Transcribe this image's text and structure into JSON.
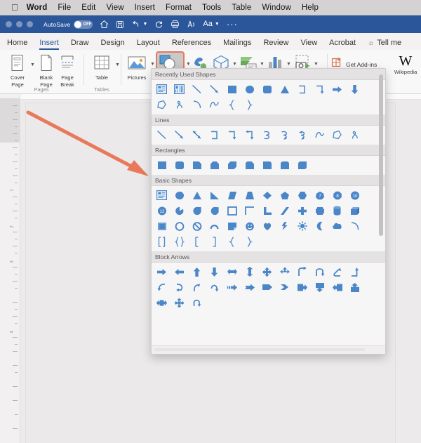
{
  "app": {
    "name": "Word",
    "accent_blue": "#2b579a",
    "shape_blue": "#4a86c8",
    "highlight_orange": "#e8795a"
  },
  "macmenu": {
    "apple_icon": "apple-icon",
    "items": [
      {
        "label": "Word",
        "bold": true
      },
      {
        "label": "File",
        "bold": false
      },
      {
        "label": "Edit",
        "bold": false
      },
      {
        "label": "View",
        "bold": false
      },
      {
        "label": "Insert",
        "bold": false
      },
      {
        "label": "Format",
        "bold": false
      },
      {
        "label": "Tools",
        "bold": false
      },
      {
        "label": "Table",
        "bold": false
      },
      {
        "label": "Window",
        "bold": false
      },
      {
        "label": "Help",
        "bold": false
      }
    ]
  },
  "quickaccess": {
    "autosave_label": "AutoSave",
    "autosave_state": "OFF",
    "icons": [
      {
        "name": "home-icon",
        "glyph": "⌂"
      },
      {
        "name": "save-icon",
        "glyph": "▤"
      },
      {
        "name": "undo-icon",
        "glyph": "↶"
      },
      {
        "name": "redo-icon",
        "glyph": "↻"
      },
      {
        "name": "print-icon",
        "glyph": "⎙"
      },
      {
        "name": "read-aloud-icon",
        "glyph": "A"
      },
      {
        "name": "font-format-icon",
        "glyph": "Aa"
      },
      {
        "name": "more-options-icon",
        "glyph": "···"
      }
    ]
  },
  "ribbon": {
    "tabs": [
      {
        "label": "Home",
        "active": false
      },
      {
        "label": "Insert",
        "active": true
      },
      {
        "label": "Draw",
        "active": false
      },
      {
        "label": "Design",
        "active": false
      },
      {
        "label": "Layout",
        "active": false
      },
      {
        "label": "References",
        "active": false
      },
      {
        "label": "Mailings",
        "active": false
      },
      {
        "label": "Review",
        "active": false
      },
      {
        "label": "View",
        "active": false
      },
      {
        "label": "Acrobat",
        "active": false
      }
    ],
    "tell_me": "Tell me",
    "groups": [
      {
        "caption": "Pages",
        "items": [
          "Cover Page",
          "Blank Page",
          "Page Break"
        ]
      },
      {
        "caption": "Tables",
        "items": [
          "Table"
        ]
      },
      {
        "caption": "",
        "items": [
          "Pictures",
          "Shapes",
          "Icons",
          "3D Models",
          "SmartArt",
          "Chart",
          "Screenshot"
        ]
      },
      {
        "caption": "",
        "items": [
          "Get Add-ins",
          "Wikipedia"
        ]
      }
    ],
    "labels": {
      "cover_page_l1": "Cover",
      "cover_page_l2": "Page",
      "blank_page_l1": "Blank",
      "blank_page_l2": "Page",
      "page_break_l1": "Page",
      "page_break_l2": "Break",
      "table": "Table",
      "pictures": "Pictures",
      "get_addins": "Get Add-ins",
      "wikipedia": "Wikipedia"
    }
  },
  "shapes_panel": {
    "sections": [
      {
        "title": "Recently Used Shapes",
        "rows": [
          [
            "text-box-shape",
            "vertical-text-box-shape",
            "line-shape",
            "line-arrow-shape",
            "rectangle-shape",
            "oval-shape",
            "rounded-rectangle-shape",
            "isosceles-triangle-shape",
            "elbow-connector-shape",
            "elbow-arrow-connector-shape",
            "right-arrow-shape",
            "down-arrow-shape"
          ],
          [
            "freeform-shape",
            "scribble-shape",
            "arc-shape",
            "curve-shape",
            "left-brace-shape",
            "right-brace-shape"
          ]
        ]
      },
      {
        "title": "Lines",
        "rows": [
          [
            "line-shape",
            "line-arrow-shape",
            "line-double-arrow-shape",
            "elbow-connector-shape",
            "elbow-arrow-connector-shape",
            "elbow-double-arrow-connector-shape",
            "curved-connector-shape",
            "curved-arrow-connector-shape",
            "curved-double-arrow-connector-shape",
            "curve-shape",
            "freeform-shape",
            "scribble-shape"
          ]
        ]
      },
      {
        "title": "Rectangles",
        "rows": [
          [
            "rectangle-shape",
            "rounded-rectangle-shape",
            "snip-single-corner-rectangle-shape",
            "snip-same-side-corner-rectangle-shape",
            "snip-diagonal-corner-rectangle-shape",
            "snip-and-round-single-corner-rectangle-shape",
            "round-single-corner-rectangle-shape",
            "round-same-side-corner-rectangle-shape",
            "round-diagonal-corner-rectangle-shape"
          ]
        ]
      },
      {
        "title": "Basic Shapes",
        "rows": [
          [
            "text-box-shape",
            "oval-shape",
            "isosceles-triangle-shape",
            "right-triangle-shape",
            "parallelogram-shape",
            "trapezoid-shape",
            "diamond-shape",
            "pentagon-shape",
            "hexagon-shape",
            "heptagon-shape",
            "octagon-shape",
            "decagon-shape"
          ],
          [
            "dodecagon-shape",
            "pie-shape",
            "teardrop-shape",
            "chord-shape",
            "frame-shape",
            "half-frame-shape",
            "l-shape",
            "diagonal-stripe-shape",
            "cross-shape",
            "plaque-shape",
            "cylinder-shape",
            "cube-shape"
          ],
          [
            "bevel-shape",
            "donut-shape",
            "no-symbol-shape",
            "block-arc-shape",
            "folded-corner-shape",
            "smiley-face-shape",
            "heart-shape",
            "lightning-bolt-shape",
            "sun-shape",
            "moon-shape",
            "cloud-shape",
            "arc-shape"
          ],
          [
            "double-bracket-shape",
            "double-brace-shape",
            "left-bracket-shape",
            "right-bracket-shape",
            "left-brace-shape",
            "right-brace-shape"
          ]
        ]
      },
      {
        "title": "Block Arrows",
        "rows": [
          [
            "right-arrow-shape",
            "left-arrow-shape",
            "up-arrow-shape",
            "down-arrow-shape",
            "left-right-arrow-shape",
            "up-down-arrow-shape",
            "four-way-arrow-shape",
            "quad-arrow-shape",
            "bent-arrow-shape",
            "u-turn-arrow-shape",
            "left-up-arrow-shape",
            "bent-up-arrow-shape"
          ],
          [
            "curved-left-arrow-shape",
            "curved-right-arrow-shape",
            "curved-up-arrow-shape",
            "curved-down-arrow-shape",
            "striped-right-arrow-shape",
            "notched-right-arrow-shape",
            "pentagon-arrow-shape",
            "chevron-arrow-shape",
            "right-arrow-callout-shape",
            "down-arrow-callout-shape",
            "left-arrow-callout-shape",
            "up-arrow-callout-shape"
          ],
          [
            "left-right-arrow-callout-shape",
            "quad-arrow-callout-shape",
            "circular-arrow-shape"
          ]
        ]
      }
    ],
    "scrollbar": "vertical-scrollbar"
  },
  "document": {
    "ruler_marks": [
      "1",
      "2",
      "3",
      "4"
    ],
    "annotation": "pointer-arrow-annotation"
  }
}
